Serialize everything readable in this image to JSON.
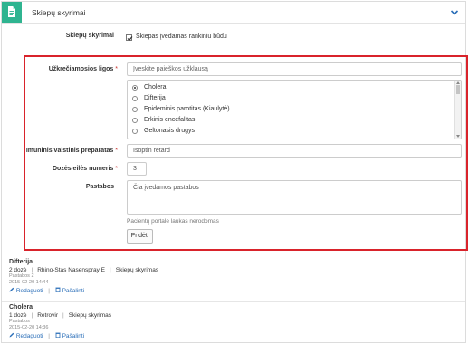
{
  "header": {
    "title": "Skiepų skyrimai"
  },
  "top": {
    "label": "Skiepų skyrimai",
    "checkbox_label": "Skiepas įvedamas rankiniu būdu"
  },
  "form": {
    "diseases_label": "Užkrečiamosios ligos",
    "search_placeholder": "Įveskite paieškos užklausą",
    "diseases": [
      {
        "label": "Cholera",
        "selected": true
      },
      {
        "label": "Difterija",
        "selected": false
      },
      {
        "label": "Epideminis parotitas (Kiaulytė)",
        "selected": false
      },
      {
        "label": "Erkinis encefalitas",
        "selected": false
      },
      {
        "label": "Geltonasis drugys",
        "selected": false
      }
    ],
    "vaccine_label": "Imuninis vaistinis preparatas",
    "vaccine_value": "Isoptin retard",
    "dose_label": "Dozės eilės numeris",
    "dose_value": "3",
    "notes_label": "Pastabos",
    "notes_value": "Čia įvedamos pastabos",
    "notes_help": "Pacientų portale laukas nerodomas",
    "add_button": "Pridėti",
    "required_mark": "*"
  },
  "entries": [
    {
      "title": "Difterija",
      "dose": "2 dozė",
      "vaccine": "Rhino-Stas Nasenspray E",
      "type": "Skiepų skyrimas",
      "note": "Pastabos 2",
      "date": "2015-02-20 14:44",
      "edit": "Redaguoti",
      "delete": "Pašalinti"
    },
    {
      "title": "Cholera",
      "dose": "1 dozė",
      "vaccine": "Retrovir",
      "type": "Skiepų skyrimas",
      "note": "Pastabos",
      "date": "2015-02-20 14:36",
      "edit": "Redaguoti",
      "delete": "Pašalinti"
    }
  ],
  "colors": {
    "accent": "#2fb490",
    "highlight_border": "#d9232b",
    "link": "#2a6eb8"
  }
}
